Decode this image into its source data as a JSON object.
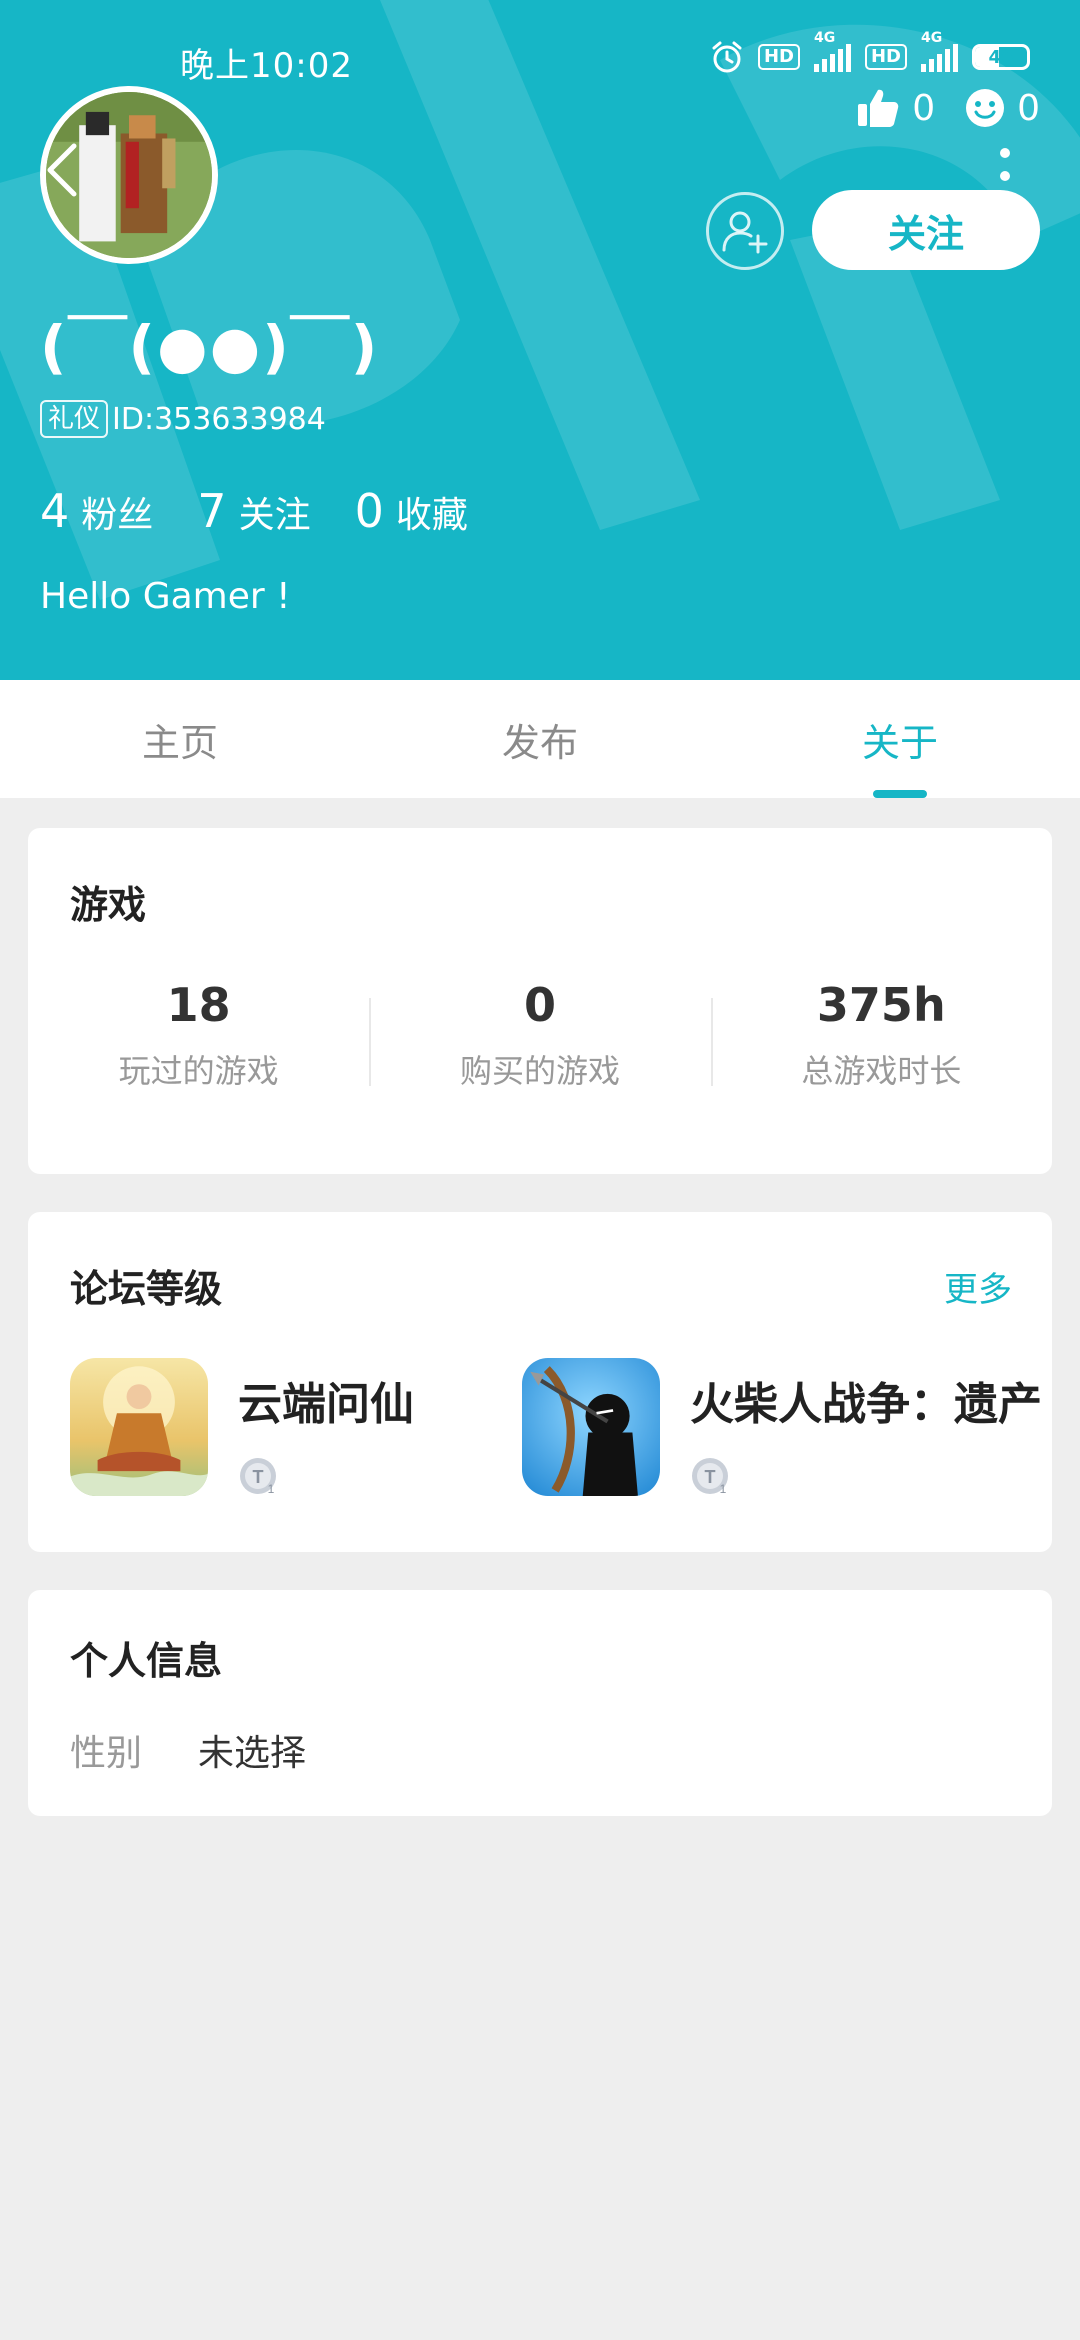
{
  "status_bar": {
    "time": "晚上10:02",
    "hd1": "HD",
    "net1": "4G",
    "hd2": "HD",
    "net2": "4G",
    "battery": "46"
  },
  "header": {
    "likes_count": "0",
    "emoji_count": "0",
    "follow_label": "关注",
    "nickname": "(￣(●●)￣)",
    "badge": "礼仪",
    "id_text": "ID:353633984",
    "stats": [
      {
        "num": "4",
        "label": "粉丝"
      },
      {
        "num": "7",
        "label": "关注"
      },
      {
        "num": "0",
        "label": "收藏"
      }
    ],
    "bio": "Hello Gamer !"
  },
  "tabs": [
    {
      "label": "主页",
      "active": false
    },
    {
      "label": "发布",
      "active": false
    },
    {
      "label": "关于",
      "active": true
    }
  ],
  "games": {
    "title": "游戏",
    "stats": [
      {
        "value": "18",
        "caption": "玩过的游戏"
      },
      {
        "value": "0",
        "caption": "购买的游戏"
      },
      {
        "value": "375h",
        "caption": "总游戏时长"
      }
    ]
  },
  "forum": {
    "title": "论坛等级",
    "more": "更多",
    "items": [
      {
        "name": "云端问仙",
        "level": "1"
      },
      {
        "name": "火柴人战争：遗产",
        "level": "1"
      }
    ]
  },
  "personal": {
    "title": "个人信息",
    "rows": [
      {
        "key": "性别",
        "value": "未选择"
      }
    ]
  },
  "colors": {
    "accent": "#16b6c6",
    "background": "#eeeeee"
  }
}
